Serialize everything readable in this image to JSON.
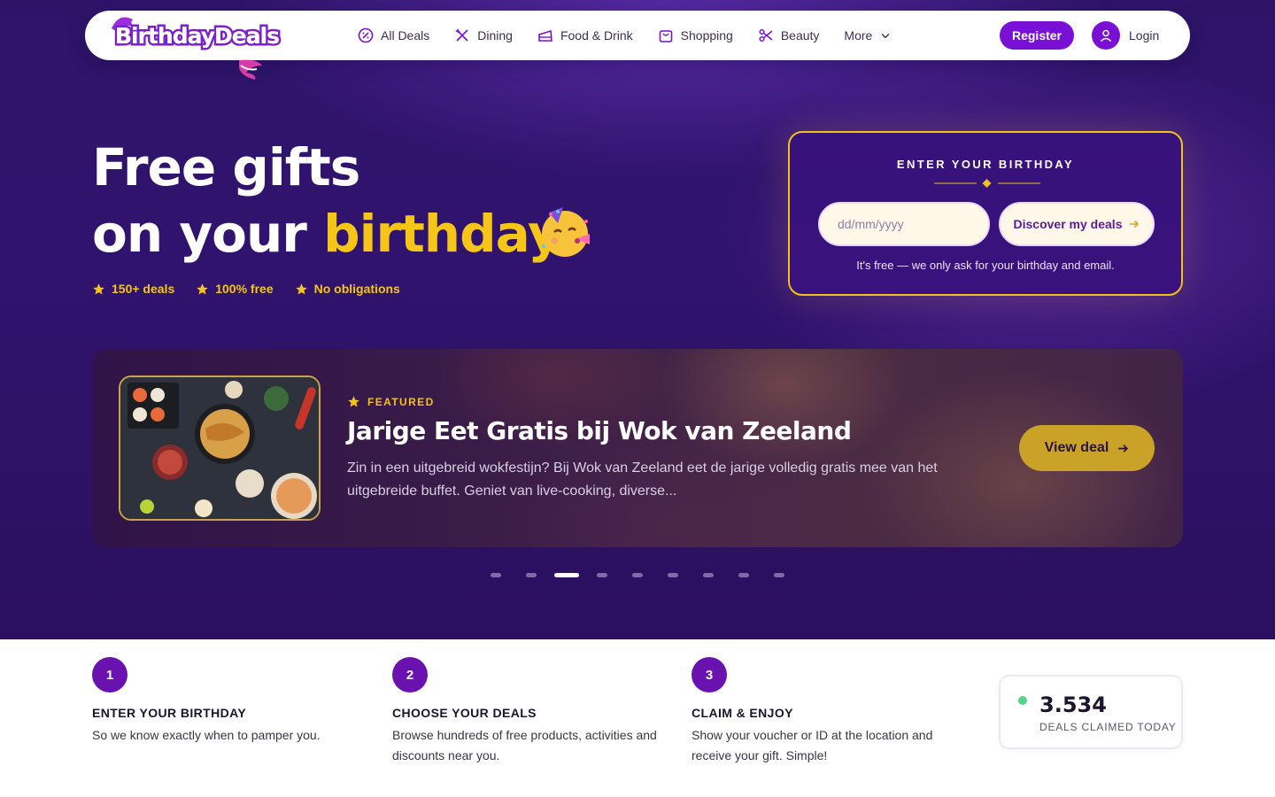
{
  "brand": {
    "name": "BirthdayDeals",
    "accent": "#7a10d6",
    "gold": "#f5c518"
  },
  "nav": {
    "items": [
      {
        "label": "All Deals",
        "icon": "percent-badge-icon"
      },
      {
        "label": "Dining",
        "icon": "fork-knife-icon"
      },
      {
        "label": "Food & Drink",
        "icon": "cake-slice-icon"
      },
      {
        "label": "Shopping",
        "icon": "shopping-bag-icon"
      },
      {
        "label": "Beauty",
        "icon": "scissors-icon"
      },
      {
        "label": "More",
        "icon": "chevron-down-icon"
      }
    ],
    "register_label": "Register",
    "login_label": "Login"
  },
  "hero": {
    "headline_line1": "Free gifts",
    "headline_line2_prefix": "on your ",
    "headline_highlight": "birthday",
    "perks": [
      "150+ deals",
      "100% free",
      "No obligations"
    ]
  },
  "birthday_form": {
    "title": "ENTER YOUR BIRTHDAY",
    "date_placeholder": "dd/mm/yyyy",
    "submit_label": "Discover my deals",
    "note": "It's free — we only ask for your birthday and email."
  },
  "featured": {
    "tag": "FEATURED",
    "title": "Jarige Eet Gratis bij Wok van Zeeland",
    "description": "Zin in een uitgebreid wokfestijn? Bij Wok van Zeeland eet de jarige volledig gratis mee van het uitgebreide buffet. Geniet van live-cooking, diverse...",
    "button_label": "View deal",
    "slide_count": 9,
    "active_slide": 3
  },
  "steps": [
    {
      "num": "1",
      "title": "ENTER YOUR BIRTHDAY",
      "desc": "So we know exactly when to pamper you."
    },
    {
      "num": "2",
      "title": "CHOOSE YOUR DEALS",
      "desc": "Browse hundreds of free products, activities and discounts near you."
    },
    {
      "num": "3",
      "title": "CLAIM & ENJOY",
      "desc": "Show your voucher or ID at the location and receive your gift. Simple!"
    }
  ],
  "stats": {
    "value": "3.534",
    "label": "DEALS CLAIMED TODAY"
  }
}
